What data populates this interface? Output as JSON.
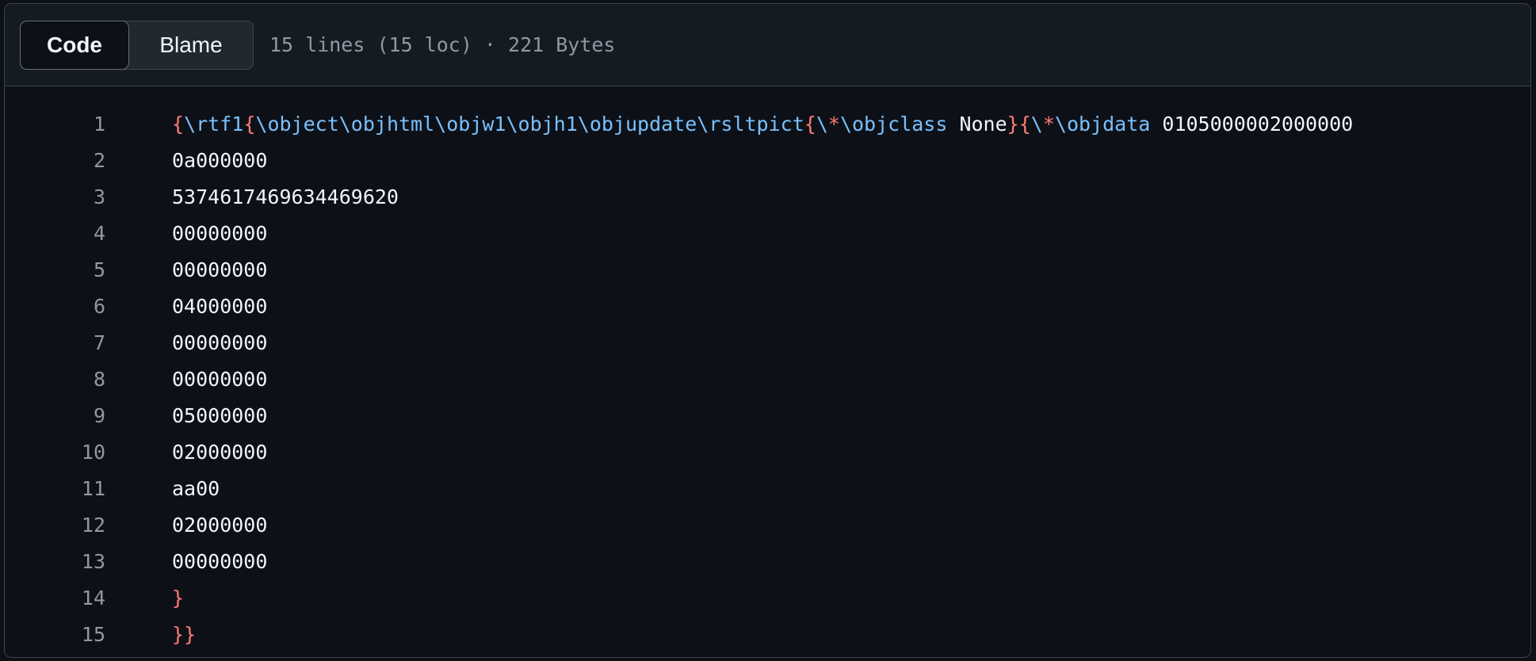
{
  "header": {
    "tabs": [
      {
        "label": "Code",
        "active": true
      },
      {
        "label": "Blame",
        "active": false
      }
    ],
    "file_info": "15 lines (15 loc) · 221 Bytes"
  },
  "code": {
    "lines": [
      {
        "number": "1",
        "tokens": [
          {
            "text": "{",
            "type": "brace"
          },
          {
            "text": "\\rtf1",
            "type": "ctrl"
          },
          {
            "text": "{",
            "type": "brace"
          },
          {
            "text": "\\object\\objhtml\\objw1\\objh1\\objupdate\\rsltpict",
            "type": "ctrl"
          },
          {
            "text": "{",
            "type": "brace"
          },
          {
            "text": "\\",
            "type": "ctrl"
          },
          {
            "text": "*",
            "type": "brace"
          },
          {
            "text": "\\objclass",
            "type": "ctrl"
          },
          {
            "text": " None",
            "type": "plain"
          },
          {
            "text": "}",
            "type": "brace"
          },
          {
            "text": "{",
            "type": "brace"
          },
          {
            "text": "\\",
            "type": "ctrl"
          },
          {
            "text": "*",
            "type": "brace"
          },
          {
            "text": "\\objdata",
            "type": "ctrl"
          },
          {
            "text": " 0105000002000000",
            "type": "plain"
          }
        ]
      },
      {
        "number": "2",
        "tokens": [
          {
            "text": "0a000000",
            "type": "plain"
          }
        ]
      },
      {
        "number": "3",
        "tokens": [
          {
            "text": "5374617469634469620",
            "type": "plain"
          }
        ]
      },
      {
        "number": "4",
        "tokens": [
          {
            "text": "00000000",
            "type": "plain"
          }
        ]
      },
      {
        "number": "5",
        "tokens": [
          {
            "text": "00000000",
            "type": "plain"
          }
        ]
      },
      {
        "number": "6",
        "tokens": [
          {
            "text": "04000000",
            "type": "plain"
          }
        ]
      },
      {
        "number": "7",
        "tokens": [
          {
            "text": "00000000",
            "type": "plain"
          }
        ]
      },
      {
        "number": "8",
        "tokens": [
          {
            "text": "00000000",
            "type": "plain"
          }
        ]
      },
      {
        "number": "9",
        "tokens": [
          {
            "text": "05000000",
            "type": "plain"
          }
        ]
      },
      {
        "number": "10",
        "tokens": [
          {
            "text": "02000000",
            "type": "plain"
          }
        ]
      },
      {
        "number": "11",
        "tokens": [
          {
            "text": "aa00",
            "type": "plain"
          }
        ]
      },
      {
        "number": "12",
        "tokens": [
          {
            "text": "02000000",
            "type": "plain"
          }
        ]
      },
      {
        "number": "13",
        "tokens": [
          {
            "text": "00000000",
            "type": "plain"
          }
        ]
      },
      {
        "number": "14",
        "tokens": [
          {
            "text": "}",
            "type": "brace"
          }
        ]
      },
      {
        "number": "15",
        "tokens": [
          {
            "text": "}}",
            "type": "brace"
          }
        ]
      }
    ]
  },
  "colors": {
    "background": "#0d1117",
    "header_background": "#151b23",
    "border": "#3d444d",
    "line_number": "#9198a1",
    "brace": "#ff7b72",
    "control_word": "#79c0ff",
    "plain_text": "#f0f6fc"
  }
}
